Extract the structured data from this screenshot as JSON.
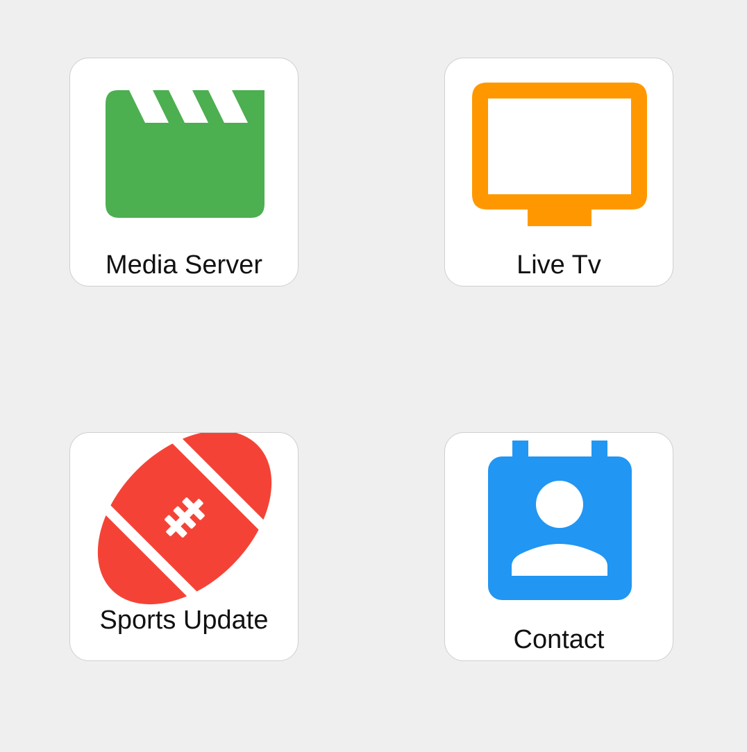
{
  "colors": {
    "background": "#efefef",
    "tile": "#ffffff",
    "media_server": "#4caf50",
    "live_tv": "#ff9800",
    "sports_update": "#f44336",
    "contact": "#2196f3"
  },
  "tiles": [
    {
      "label": "Media Server",
      "icon": "clapperboard-icon"
    },
    {
      "label": "Live Tv",
      "icon": "tv-icon"
    },
    {
      "label": "Sports Update",
      "icon": "football-icon"
    },
    {
      "label": "Contact",
      "icon": "contact-card-icon"
    }
  ]
}
